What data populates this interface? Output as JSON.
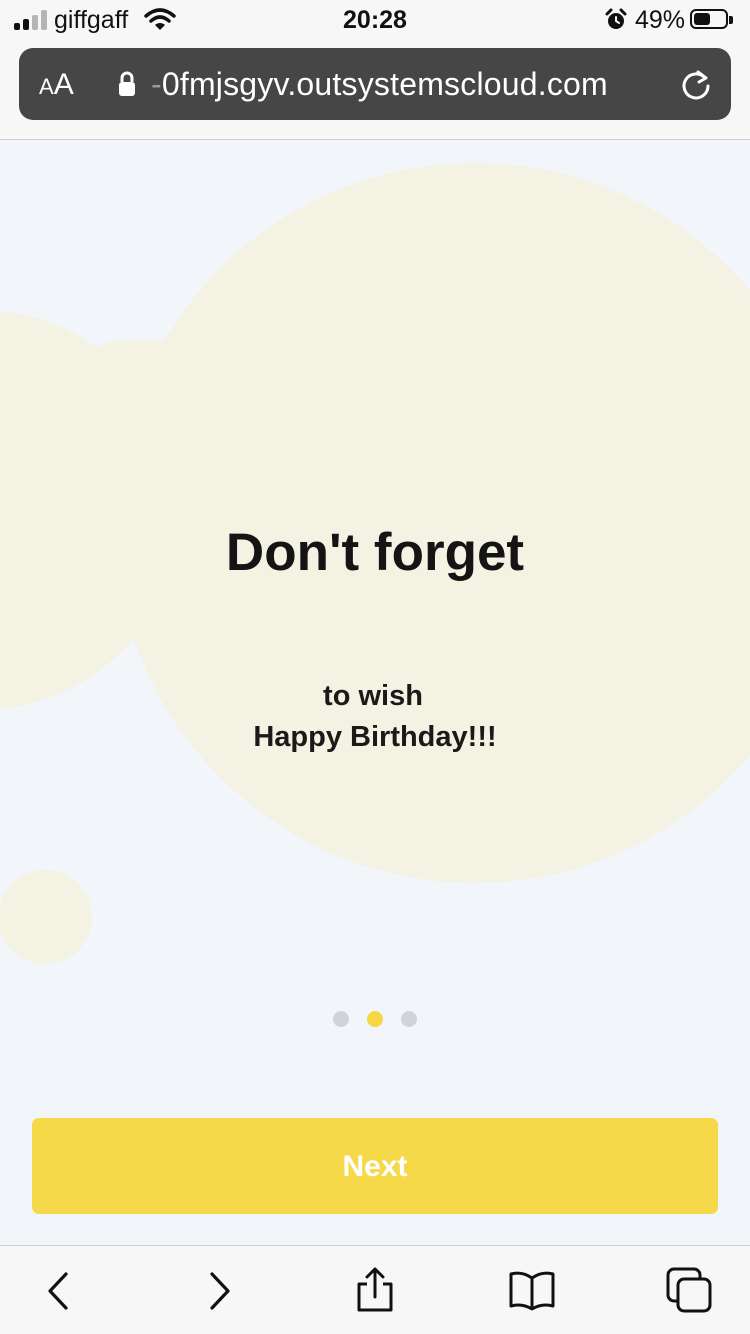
{
  "status_bar": {
    "carrier": "giffgaff",
    "time": "20:28",
    "battery_percent": "49%",
    "signal_bars_active": 2,
    "signal_bars_total": 4,
    "battery_level": 0.49
  },
  "browser": {
    "aa_small": "A",
    "aa_big": "A",
    "url_prefix": "-",
    "url": "0fmjsgyv.outsystemscloud.com"
  },
  "onboarding": {
    "title": "Don't forget",
    "subtitle_line1": "to wish",
    "subtitle_line2": "Happy Birthday!!!",
    "page_count": 3,
    "active_page": 2,
    "next_label": "Next"
  },
  "toolbar": {
    "icons": [
      "back-icon",
      "forward-icon",
      "share-icon",
      "bookmarks-icon",
      "tabs-icon"
    ]
  },
  "colors": {
    "background": "#f2f5f9",
    "blob": "#f4f2e2",
    "accent": "#f5d949",
    "dot_inactive": "#d1d3d8"
  }
}
